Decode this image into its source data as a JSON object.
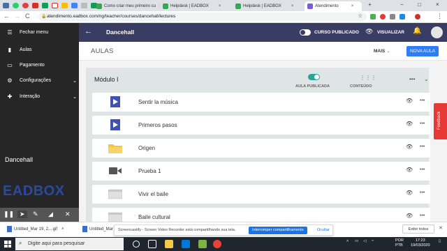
{
  "browser": {
    "tabs": [
      {
        "label": "Como criar meu primeiro cu",
        "favicon_color": "#34a853"
      },
      {
        "label": "Helpdesk | EADBOX",
        "favicon_color": "#34a853"
      },
      {
        "label": "Helpdesk | EADBOX",
        "favicon_color": "#34a853"
      },
      {
        "label": "Atendimento",
        "favicon_color": "#7b5cd6"
      }
    ],
    "tab_close": "×",
    "new_tab": "+",
    "window_controls": [
      "−",
      "□",
      "×"
    ],
    "url": "atendimento.eadbox.com/ng/teacher/courses/dancehall/lectures",
    "nav": {
      "back": "←",
      "forward": "→",
      "reload": "C"
    }
  },
  "sidebar": {
    "menu_label": "Fechar menu",
    "items": [
      {
        "label": "Aulas",
        "icon": "book-icon",
        "glyph": "▮",
        "has_chevron": false
      },
      {
        "label": "Pagamento",
        "icon": "card-icon",
        "glyph": "▭",
        "has_chevron": false
      },
      {
        "label": "Configurações",
        "icon": "gear-icon",
        "glyph": "⚙",
        "has_chevron": true
      },
      {
        "label": "Interação",
        "icon": "puzzle-icon",
        "glyph": "✚",
        "has_chevron": true
      }
    ],
    "course_name": "Dancehall",
    "logo_text": "EADBOX"
  },
  "header": {
    "title": "Dancehall",
    "published_label": "CURSO PUBLICADO",
    "view_label": "VISUALIZAR"
  },
  "aulas_bar": {
    "title": "AULAS",
    "more_label": "MAIS",
    "new_lesson_label": "NOVA AULA"
  },
  "module": {
    "title": "Módulo I",
    "published_label": "AULA PUBLICADA",
    "content_label": "CONTEÚDO"
  },
  "lessons": [
    {
      "name": "Sentir la música",
      "type": "video-doc"
    },
    {
      "name": "Primeros pasos",
      "type": "video-doc"
    },
    {
      "name": "Origen",
      "type": "folder"
    },
    {
      "name": "Prueba 1",
      "type": "camera"
    },
    {
      "name": "Vivir el baile",
      "type": "page"
    },
    {
      "name": "Baile cultural",
      "type": "page"
    }
  ],
  "feedback_label": "Feedback",
  "download_bar": {
    "files": [
      "Untitled_Mar 19, 2....gif",
      "Untitled_Mar 1..."
    ],
    "share_message": "Screencastify - Screen Video Recorder está compartilhando sua tela.",
    "stop_share_label": "Interromper compartilhamento",
    "hide_label": "Ocultar",
    "show_all_label": "Exibir todos"
  },
  "taskbar": {
    "search_placeholder": "Digite aqui para pesquisar",
    "lang": "POR",
    "lang2": "PTB",
    "time": "17:23",
    "date": "19/03/2020"
  },
  "colors": {
    "header": "#3a3d63",
    "sidebar": "#262626",
    "accent": "#2e7cf6",
    "toggle_on": "#26a69a",
    "feedback": "#e53935"
  }
}
